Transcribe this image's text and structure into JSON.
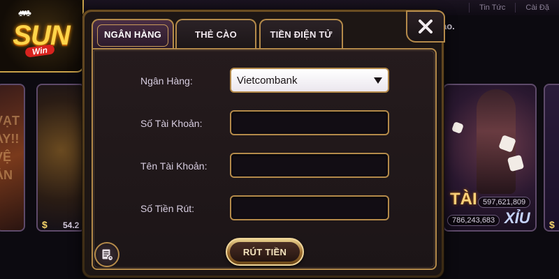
{
  "background": {
    "nav": [
      "Tin Tức",
      "Cài Đặ"
    ],
    "notice": "ào.",
    "logo": {
      "main": "SUN",
      "sub": "Win",
      "cards": "♠♥♣"
    },
    "left_tile": {
      "side_text": "VẠT\nAY!!\nVỆ\nẢN",
      "amount": "54.2"
    },
    "right_tile": {
      "tai": "TÀI",
      "xiu": "XỈU",
      "num_top": "597,621,809",
      "num_bottom": "786,243,683"
    }
  },
  "dialog": {
    "tabs": [
      {
        "label": "NGÂN HÀNG",
        "active": true
      },
      {
        "label": "THẺ CÀO",
        "active": false
      },
      {
        "label": "TIỀN ĐIỆN TỬ",
        "active": false
      }
    ],
    "close_icon": "close-x-icon",
    "fields": {
      "bank": {
        "label": "Ngân Hàng:",
        "value": "Vietcombank"
      },
      "account_number": {
        "label": "Số Tài Khoản:",
        "value": ""
      },
      "account_name": {
        "label": "Tên Tài Khoản:",
        "value": ""
      },
      "amount": {
        "label": "Số Tiền Rút:",
        "value": ""
      }
    },
    "submit_label": "RÚT TIỀN",
    "history_icon": "document-history-icon"
  },
  "colors": {
    "gold_border": "#b48a4a",
    "panel_bg": "#1d1614",
    "field_bg": "#120d14",
    "active_tab": "#4a2e44"
  }
}
